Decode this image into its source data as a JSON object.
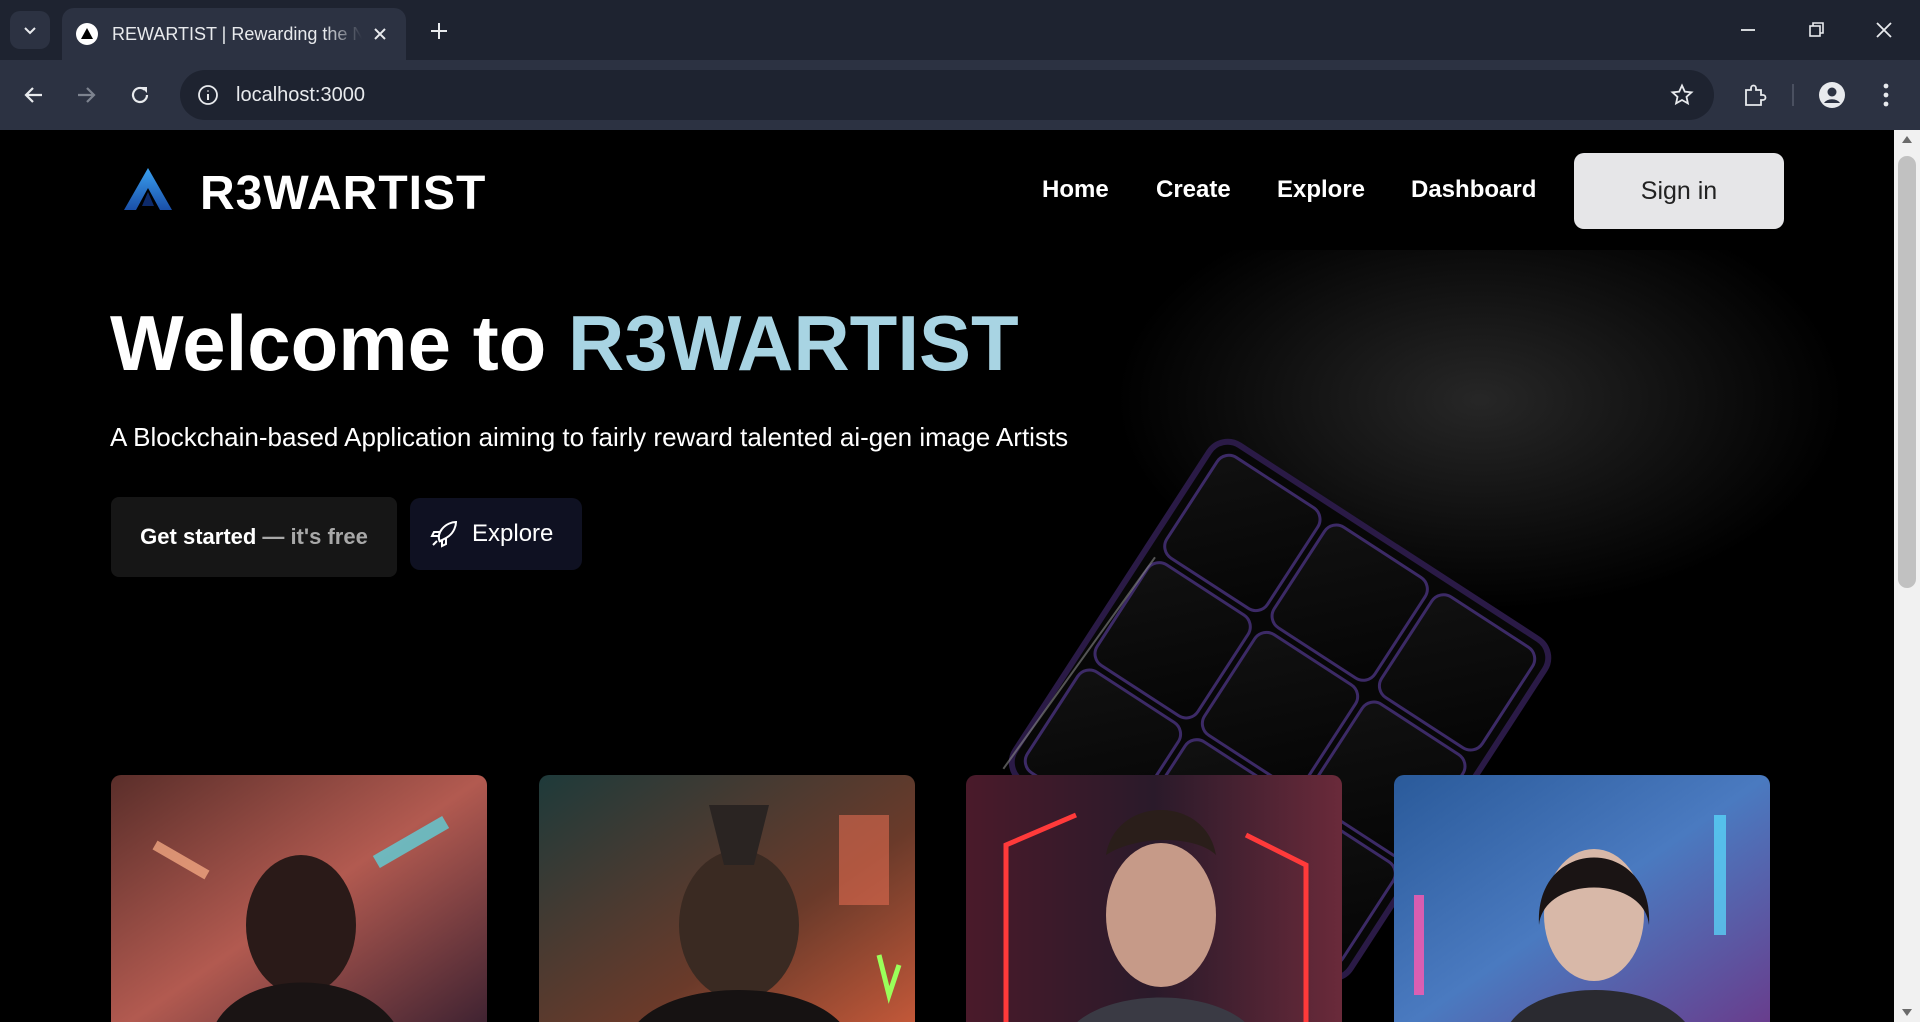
{
  "browser": {
    "tab_title": "REWARTIST | Rewarding the New Generation of Artists",
    "url": "localhost:3000"
  },
  "site": {
    "brand": "R3WARTIST",
    "nav": [
      "Home",
      "Create",
      "Explore",
      "Dashboard"
    ],
    "sign_in": "Sign in"
  },
  "hero": {
    "title_prefix": "Welcome to",
    "title_accent": "R3WARTIST",
    "subtitle": "A Blockchain-based Application aiming to fairly reward talented ai-gen image Artists",
    "cta_primary": "Get started",
    "cta_primary_suffix": "— it's free",
    "cta_secondary": "Explore"
  },
  "gallery": {
    "cards": [
      "cyberpunk-dreadlocks-portrait",
      "cyberpunk-mohawk-portrait",
      "cyberpunk-man-red-neon-portrait",
      "cyberpunk-man-rain-portrait"
    ]
  },
  "colors": {
    "accent": "#a8d4e3",
    "chrome_dark": "#1e2330",
    "chrome_light": "#2c3242"
  }
}
